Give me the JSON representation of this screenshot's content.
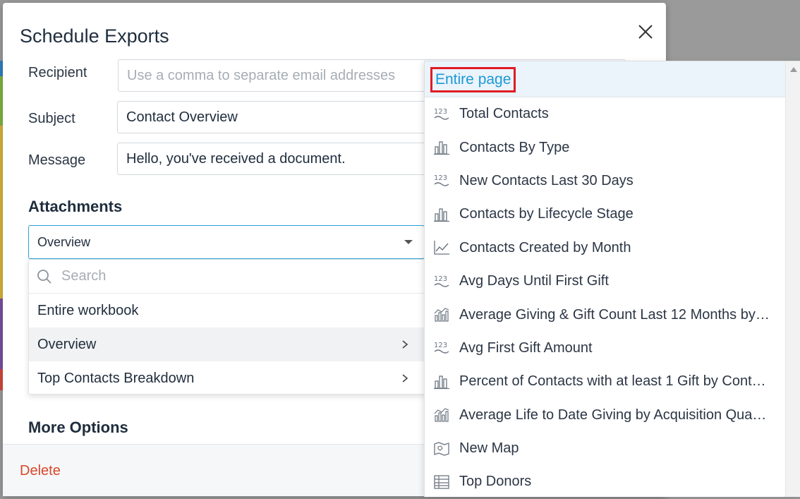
{
  "modal": {
    "title": "Schedule Exports",
    "recipient_label": "Recipient",
    "recipient_placeholder": "Use a comma to separate email addresses",
    "subject_label": "Subject",
    "subject_value": "Contact Overview",
    "message_label": "Message",
    "message_value": "Hello, you've received a document.",
    "attachments_title": "Attachments",
    "more_options_title": "More Options",
    "delete_label": "Delete"
  },
  "attachment_select": {
    "selected": "Overview",
    "search_placeholder": "Search",
    "options": [
      {
        "label": "Entire workbook",
        "has_submenu": false
      },
      {
        "label": "Overview",
        "has_submenu": true
      },
      {
        "label": "Top Contacts Breakdown",
        "has_submenu": true
      }
    ]
  },
  "subpanel": {
    "entire_page_label": "Entire page",
    "items": [
      {
        "label": "Total Contacts",
        "icon": "number-kpi-icon"
      },
      {
        "label": "Contacts By Type",
        "icon": "bar-chart-icon"
      },
      {
        "label": "New Contacts Last 30 Days",
        "icon": "number-kpi-icon"
      },
      {
        "label": "Contacts by Lifecycle Stage",
        "icon": "bar-chart-icon"
      },
      {
        "label": "Contacts Created by Month",
        "icon": "line-chart-icon"
      },
      {
        "label": "Avg Days Until First Gift",
        "icon": "number-kpi-icon"
      },
      {
        "label": "Average Giving & Gift Count Last 12 Months by…",
        "icon": "combo-chart-icon"
      },
      {
        "label": "Avg First Gift Amount",
        "icon": "number-kpi-icon"
      },
      {
        "label": "Percent of Contacts with at least 1 Gift by Cont…",
        "icon": "bar-chart-icon"
      },
      {
        "label": "Average Life to Date Giving by Acquisition Qua…",
        "icon": "combo-chart-icon"
      },
      {
        "label": "New Map",
        "icon": "map-icon"
      },
      {
        "label": "Top Donors",
        "icon": "table-icon"
      }
    ]
  },
  "colors": {
    "accent": "#2c9fd8",
    "link": "#1b9ad6",
    "highlight_border": "#e01b24",
    "delete": "#d9472b"
  }
}
